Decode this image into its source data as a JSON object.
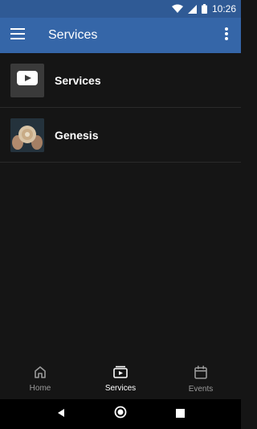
{
  "status_bar": {
    "time": "10:26",
    "icons": [
      "wifi-icon",
      "signal-icon",
      "battery-icon"
    ]
  },
  "app_bar": {
    "title": "Services",
    "background_color": "#3566a8",
    "menu_icon": "hamburger-menu-icon",
    "overflow_icon": "more-vert-icon"
  },
  "list": {
    "items": [
      {
        "label": "Services",
        "thumbnail": "youtube-icon"
      },
      {
        "label": "Genesis",
        "thumbnail": "photo-thumbnail"
      }
    ]
  },
  "bottom_nav": {
    "items": [
      {
        "label": "Home",
        "icon": "home-icon",
        "active": false
      },
      {
        "label": "Services",
        "icon": "video-library-icon",
        "active": true
      },
      {
        "label": "Events",
        "icon": "calendar-icon",
        "active": false
      }
    ]
  },
  "system_nav": {
    "buttons": [
      "back-icon",
      "home-circle-icon",
      "recents-icon"
    ]
  }
}
